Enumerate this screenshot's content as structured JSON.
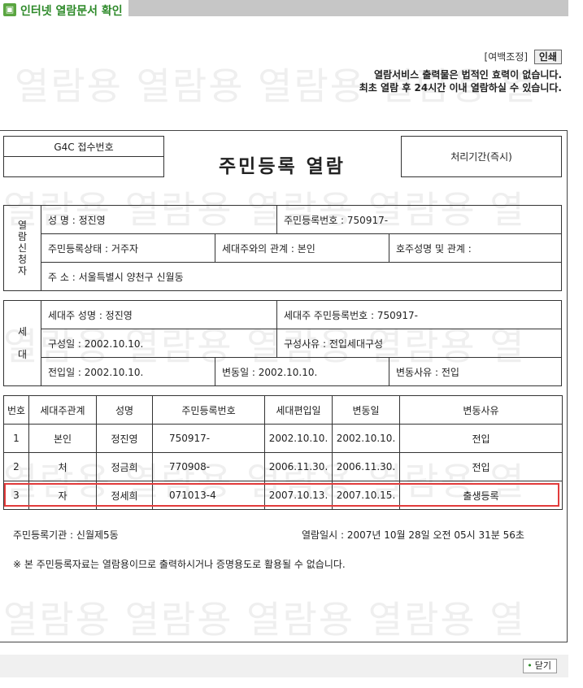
{
  "header": {
    "title": "인터넷 열람문서 확인",
    "icon": "document-icon"
  },
  "watermark": "열람용 열람용 열람용 열람용 열",
  "controls": {
    "margin_label": "[여백조정]",
    "print_button": "인쇄"
  },
  "notice": {
    "line1": "열람서비스 출력물은 법적인 효력이 없습니다.",
    "line2": "최초 열람 후 24시간 이내 열람하실 수 있습니다."
  },
  "document": {
    "receipt_label": "G4C 접수번호",
    "receipt_value": "",
    "title": "주민등록 열람",
    "processing": "처리기간(즉시)"
  },
  "applicant": {
    "section_label": [
      "열",
      "람",
      "신",
      "청",
      "자"
    ],
    "name": "성 명 : 정진영",
    "reg_no": "주민등록번호 : 750917-",
    "status": "주민등록상태 : 거주자",
    "relation": "세대주와의 관계 : 본인",
    "head_name": "호주성명 및 관계 :",
    "address": "주 소 : 서울특별시 양천구 신월동"
  },
  "household": {
    "section_label": [
      "세",
      "대"
    ],
    "head_name": "세대주 성명 : 정진영",
    "head_reg_no": "세대주 주민등록번호 : 750917-",
    "formed_date": "구성일 : 2002.10.10.",
    "formed_reason": "구성사유 : 전입세대구성",
    "movein_date": "전입일 : 2002.10.10.",
    "change_date": "변동일 : 2002.10.10.",
    "change_reason": "변동사유 : 전입"
  },
  "members": {
    "headers": [
      "번호",
      "세대주관계",
      "성명",
      "주민등록번호",
      "세대편입일",
      "변동일",
      "변동사유"
    ],
    "rows": [
      [
        "1",
        "본인",
        "정진영",
        "750917-",
        "2002.10.10.",
        "2002.10.10.",
        "전입"
      ],
      [
        "2",
        "처",
        "정금희",
        "770908-",
        "2006.11.30.",
        "2006.11.30.",
        "전입"
      ],
      [
        "3",
        "자",
        "정세희",
        "071013-4",
        "2007.10.13.",
        "2007.10.15.",
        "출생등록"
      ]
    ]
  },
  "footer": {
    "office": "주민등록기관 : 신월제5동",
    "viewed": "열람일시 : 2007년 10월 28일 오전 05시 31분 56초",
    "disclaimer": "※ 본 주민등록자료는 열람용이므로 출력하시거나 증명용도로 활용될 수 없습니다."
  },
  "close_button": "닫기",
  "colors": {
    "brand": "#2e8a2a",
    "highlight": "#e23b3b"
  }
}
